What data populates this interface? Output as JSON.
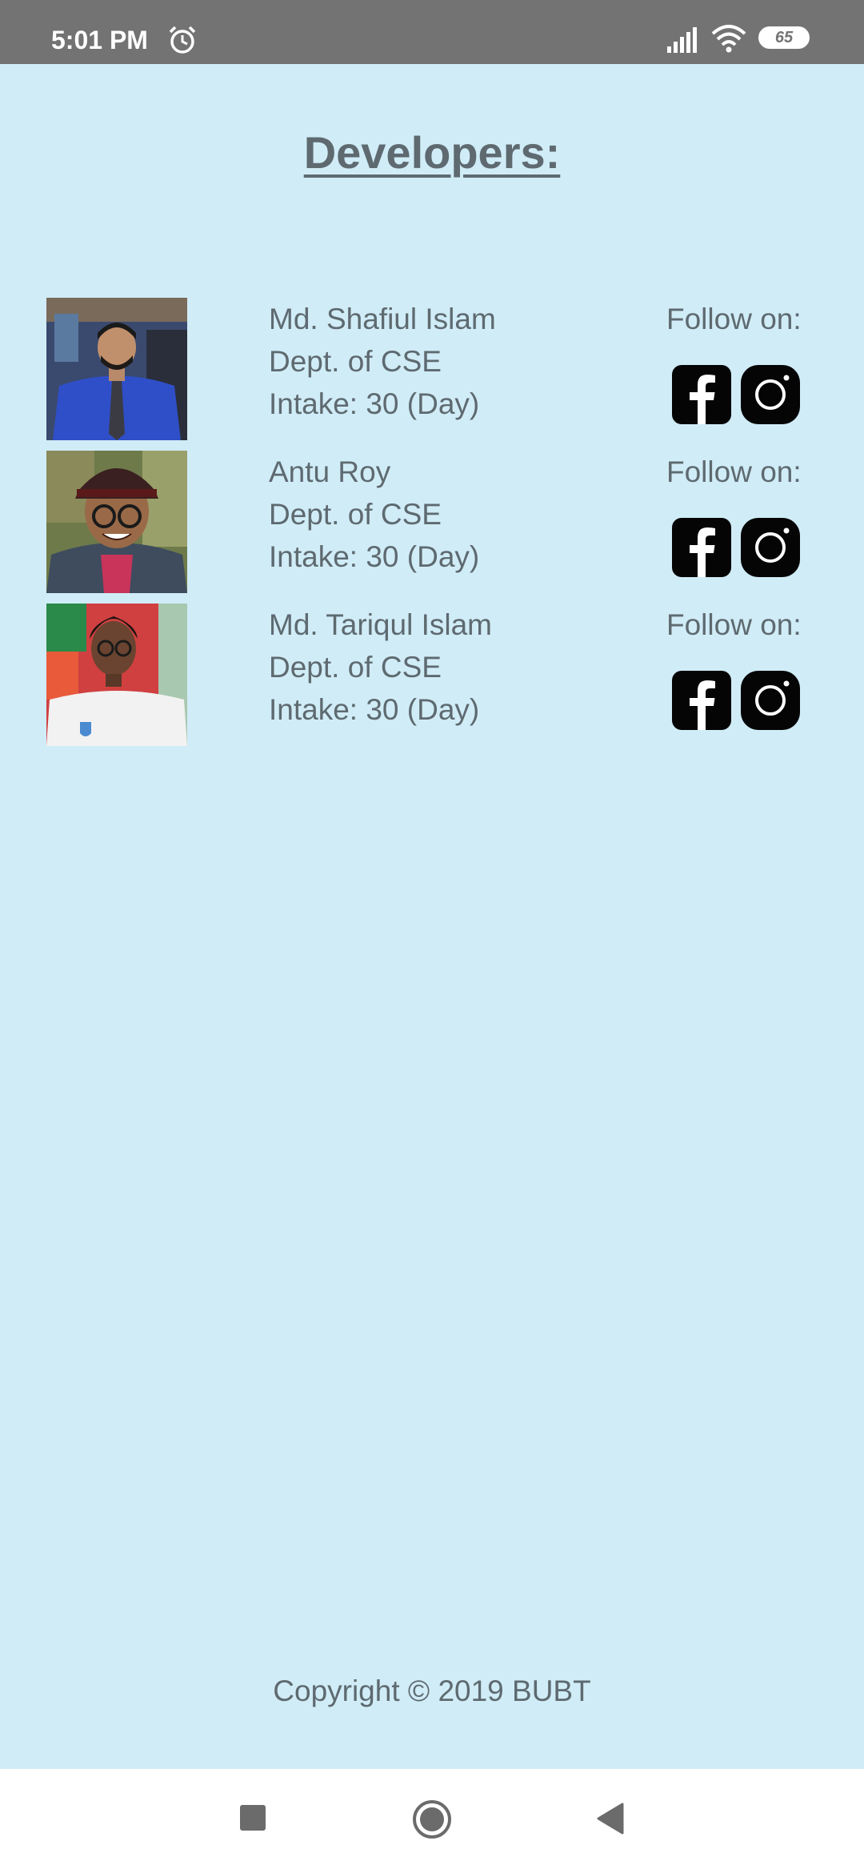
{
  "status_bar": {
    "time": "5:01 PM",
    "alarm_icon": "alarm-clock-icon",
    "signal_icon": "cellular-signal-icon",
    "wifi_icon": "wifi-icon",
    "battery_level": "65"
  },
  "page": {
    "title": "Developers:"
  },
  "developers": [
    {
      "name": "Md. Shafiul Islam",
      "dept": "Dept. of CSE",
      "intake": "Intake: 30 (Day)",
      "follow_label": "Follow on:"
    },
    {
      "name": "Antu Roy",
      "dept": "Dept. of CSE",
      "intake": "Intake: 30 (Day)",
      "follow_label": "Follow on:"
    },
    {
      "name": "Md. Tariqul Islam",
      "dept": "Dept. of CSE",
      "intake": "Intake: 30 (Day)",
      "follow_label": "Follow on:"
    }
  ],
  "social_icons": [
    "facebook-icon",
    "instagram-icon"
  ],
  "footer": {
    "copyright": "Copyright © 2019 BUBT"
  },
  "nav_bar": {
    "recent_icon": "recent-apps-icon",
    "home_icon": "home-icon",
    "back_icon": "back-icon"
  },
  "colors": {
    "background": "#d0ecf7",
    "status_bar": "#737373",
    "text": "#5e6a70",
    "nav_bar": "#ffffff"
  }
}
